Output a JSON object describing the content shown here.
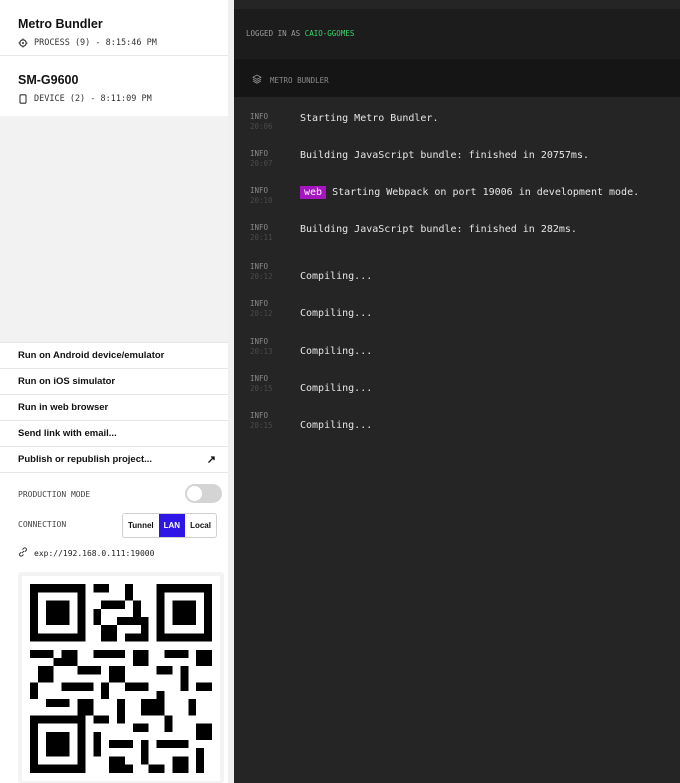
{
  "sidebar": {
    "processes": [
      {
        "title": "Metro Bundler",
        "subtitle": "PROCESS (9) - 8:15:46 PM",
        "icon": "gear-icon"
      },
      {
        "title": "SM-G9600",
        "subtitle": "DEVICE (2) - 8:11:09 PM",
        "icon": "device-icon"
      }
    ],
    "actions": [
      {
        "label": "Run on Android device/emulator"
      },
      {
        "label": "Run on iOS simulator"
      },
      {
        "label": "Run in web browser"
      },
      {
        "label": "Send link with email..."
      },
      {
        "label": "Publish or republish project...",
        "icon": "external-link-icon",
        "glyph": "↗"
      }
    ],
    "production_mode": {
      "label": "PRODUCTION MODE",
      "enabled": false
    },
    "connection": {
      "label": "CONNECTION",
      "options": [
        "Tunnel",
        "LAN",
        "Local"
      ],
      "selected": "LAN"
    },
    "url": "exp://192.168.0.111:19000"
  },
  "main": {
    "logged_in_prefix": "LOGGED IN AS ",
    "username": "CAIO-GGOMES",
    "tab_title": "METRO BUNDLER",
    "logs": [
      {
        "level": "INFO",
        "time": "20:06",
        "message": "Starting Metro Bundler."
      },
      {
        "level": "INFO",
        "time": "20:07",
        "message": "Building JavaScript bundle: finished in 20757ms."
      },
      {
        "level": "INFO",
        "time": "20:10",
        "tag": "web",
        "message": "Starting Webpack on port 19006 in development mode."
      },
      {
        "level": "INFO",
        "time": "20:11",
        "message": "Building JavaScript bundle: finished in 282ms."
      },
      {
        "level": "INFO",
        "time": "20:12",
        "message": "Compiling..."
      },
      {
        "level": "INFO",
        "time": "20:12",
        "message": "Compiling..."
      },
      {
        "level": "INFO",
        "time": "20:13",
        "message": "Compiling..."
      },
      {
        "level": "INFO",
        "time": "20:15",
        "message": "Compiling..."
      },
      {
        "level": "INFO",
        "time": "20:15",
        "message": "Compiling..."
      }
    ]
  },
  "colors": {
    "accent": "#2e16e6",
    "username": "#3ad36a",
    "web_tag": "#a616c0",
    "console_bg": "#252525"
  }
}
